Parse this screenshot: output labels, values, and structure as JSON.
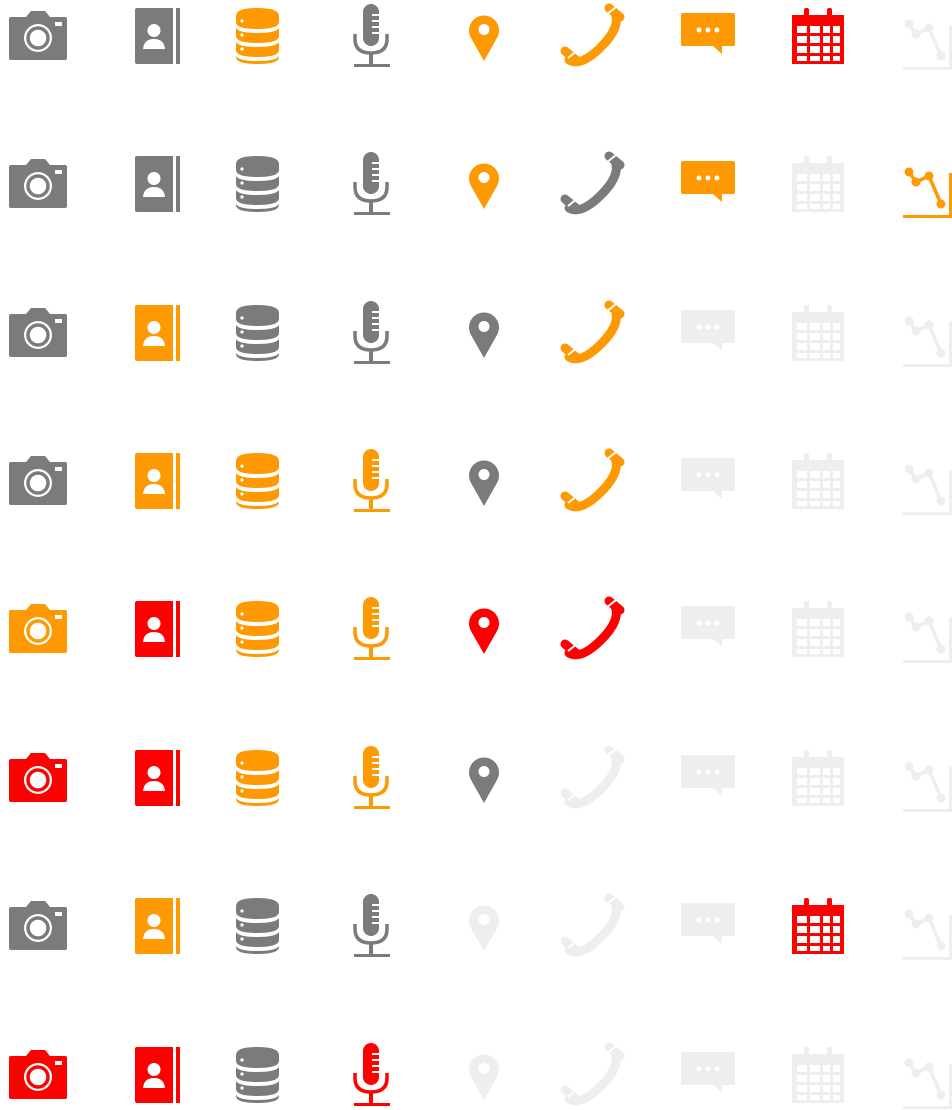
{
  "colors": {
    "gray": "#7b7b7b",
    "orange": "#fe9901",
    "red": "#fe0000",
    "light": "#eeeeee"
  },
  "columns": [
    "camera",
    "contact-book",
    "database",
    "microphone",
    "map-pin",
    "phone",
    "chat",
    "calendar",
    "chart"
  ],
  "rows": [
    [
      "gray",
      "gray",
      "orange",
      "gray",
      "orange",
      "orange",
      "orange",
      "red",
      "light"
    ],
    [
      "gray",
      "gray",
      "gray",
      "gray",
      "orange",
      "gray",
      "orange",
      "light",
      "orange"
    ],
    [
      "gray",
      "orange",
      "gray",
      "gray",
      "gray",
      "orange",
      "light",
      "light",
      "light"
    ],
    [
      "gray",
      "orange",
      "orange",
      "orange",
      "gray",
      "orange",
      "light",
      "light",
      "light"
    ],
    [
      "orange",
      "red",
      "orange",
      "orange",
      "red",
      "red",
      "light",
      "light",
      "light"
    ],
    [
      "red",
      "red",
      "orange",
      "orange",
      "gray",
      "light",
      "light",
      "light",
      "light"
    ],
    [
      "gray",
      "orange",
      "gray",
      "gray",
      "light",
      "light",
      "light",
      "red",
      "light"
    ],
    [
      "red",
      "red",
      "gray",
      "red",
      "light",
      "light",
      "light",
      "light",
      "light"
    ]
  ]
}
